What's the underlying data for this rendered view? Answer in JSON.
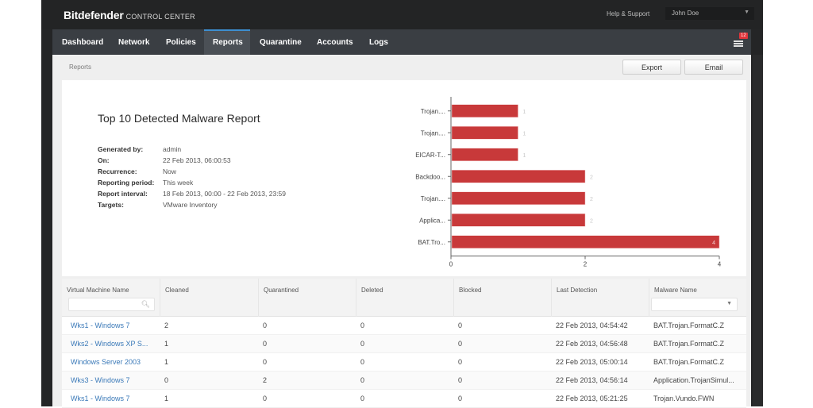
{
  "app": {
    "brand": "Bitdefender",
    "brand_sub": "CONTROL CENTER",
    "help_label": "Help & Support",
    "user_name": "John Doe"
  },
  "nav": {
    "items": [
      {
        "label": "Dashboard",
        "active": false
      },
      {
        "label": "Network",
        "active": false
      },
      {
        "label": "Policies",
        "active": false
      },
      {
        "label": "Reports",
        "active": true
      },
      {
        "label": "Quarantine",
        "active": false
      },
      {
        "label": "Accounts",
        "active": false
      },
      {
        "label": "Logs",
        "active": false
      }
    ],
    "notification_count": "12",
    "notification_icon": "menu-notifications-icon"
  },
  "breadcrumb": "Reports",
  "toolbar": {
    "export_label": "Export",
    "email_label": "Email"
  },
  "report": {
    "title": "Top 10 Detected Malware Report",
    "meta": [
      {
        "label": "Generated by:",
        "value": "admin"
      },
      {
        "label": "On:",
        "value": "22 Feb 2013, 06:00:53"
      },
      {
        "label": "Recurrence:",
        "value": "Now"
      },
      {
        "label": "Reporting period:",
        "value": "This week"
      },
      {
        "label": "Report interval:",
        "value": "18 Feb 2013, 00:00 - 22 Feb 2013, 23:59"
      },
      {
        "label": "Targets:",
        "value": "VMware Inventory"
      }
    ]
  },
  "chart_data": {
    "type": "bar",
    "orientation": "horizontal",
    "title": "",
    "categories": [
      "Trojan....",
      "Trojan....",
      "EICAR-T...",
      "Backdoo...",
      "Trojan....",
      "Applica...",
      "BAT.Tro..."
    ],
    "values": [
      1,
      1,
      1,
      2,
      2,
      2,
      4
    ],
    "xlim": [
      0,
      4
    ],
    "xticks": [
      "0",
      "2",
      "4"
    ],
    "xlabel": "",
    "ylabel": "",
    "bar_color": "#c8393a",
    "grid": false,
    "legend": "none"
  },
  "table": {
    "columns": [
      "Virtual Machine Name",
      "Cleaned",
      "Quarantined",
      "Deleted",
      "Blocked",
      "Last Detection",
      "Malware Name"
    ],
    "filter_placeholder": "",
    "rows": [
      [
        "Wks1 - Windows 7",
        "2",
        "0",
        "0",
        "0",
        "22 Feb 2013, 04:54:42",
        "BAT.Trojan.FormatC.Z"
      ],
      [
        "Wks2 - Windows XP S...",
        "1",
        "0",
        "0",
        "0",
        "22 Feb 2013, 04:56:48",
        "BAT.Trojan.FormatC.Z"
      ],
      [
        "Windows Server 2003",
        "1",
        "0",
        "0",
        "0",
        "22 Feb 2013, 05:00:14",
        "BAT.Trojan.FormatC.Z"
      ],
      [
        "Wks3 - Windows 7",
        "0",
        "2",
        "0",
        "0",
        "22 Feb 2013, 04:56:14",
        "Application.TrojanSimul..."
      ],
      [
        "Wks1 - Windows 7",
        "1",
        "0",
        "0",
        "0",
        "22 Feb 2013, 05:21:25",
        "Trojan.Vundo.FWN"
      ]
    ]
  }
}
